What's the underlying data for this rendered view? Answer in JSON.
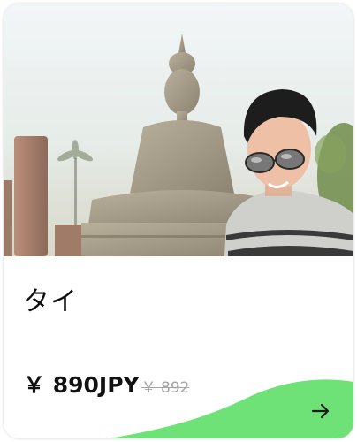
{
  "card": {
    "country": "タイ",
    "price": "￥ 890JPY",
    "old_price": "￥ 892",
    "image_icon": "thailand-buddha-photo",
    "action_icon": "arrow-right-icon",
    "accent_color": "#6fe277"
  }
}
